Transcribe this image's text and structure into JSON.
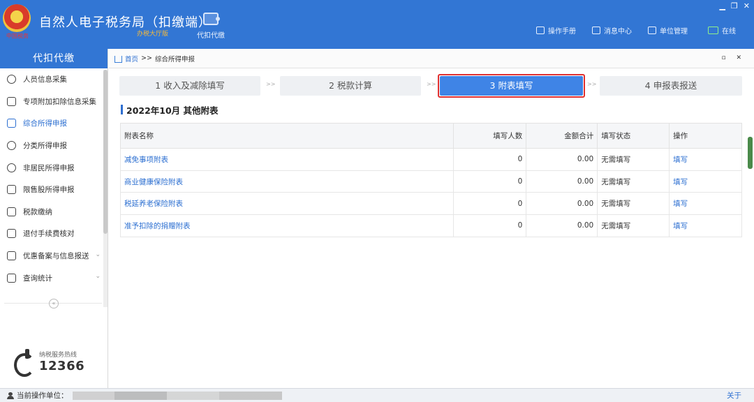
{
  "header": {
    "emblem_text": "中国税务",
    "app_title": "自然人电子税务局（扣缴端）",
    "app_subtitle": "办税大厅版",
    "module_label": "代扣代缴",
    "nav": [
      {
        "label": "操作手册",
        "icon": "book-icon"
      },
      {
        "label": "消息中心",
        "icon": "mail-icon"
      },
      {
        "label": "单位管理",
        "icon": "building-icon"
      }
    ],
    "online_label": "在线",
    "window_controls": {
      "min": "▁",
      "max": "❐",
      "close": "✕"
    }
  },
  "sidebar": {
    "title": "代扣代缴",
    "items": [
      {
        "label": "人员信息采集",
        "icon": "person-icon",
        "active": false
      },
      {
        "label": "专项附加扣除信息采集",
        "icon": "list-icon",
        "active": false
      },
      {
        "label": "综合所得申报",
        "icon": "layers-icon",
        "active": true
      },
      {
        "label": "分类所得申报",
        "icon": "pie-icon",
        "active": false
      },
      {
        "label": "非居民所得申报",
        "icon": "person-icon",
        "active": false
      },
      {
        "label": "限售股所得申报",
        "icon": "bar-chart-icon",
        "active": false
      },
      {
        "label": "税款缴纳",
        "icon": "wallet-icon",
        "active": false
      },
      {
        "label": "退付手续费核对",
        "icon": "document-icon",
        "active": false
      },
      {
        "label": "优惠备案与信息报送",
        "icon": "file-icon",
        "active": false,
        "expandable": true
      },
      {
        "label": "查询统计",
        "icon": "search-list-icon",
        "active": false,
        "expandable": true
      }
    ],
    "collapse_symbol": "«",
    "hotline_label": "纳税服务热线",
    "hotline_number": "12366"
  },
  "main": {
    "breadcrumb": {
      "home": "首页",
      "sep": ">>",
      "current": "综合所得申报"
    },
    "panel_controls": "▫ ✕",
    "steps": [
      {
        "label": "1 收入及减除填写",
        "active": false
      },
      {
        "label": "2 税款计算",
        "active": false
      },
      {
        "label": "3 附表填写",
        "active": true
      },
      {
        "label": "4 申报表报送",
        "active": false
      }
    ],
    "step_arrow": ">>",
    "section_title": "2022年10月  其他附表",
    "table": {
      "headers": [
        "附表名称",
        "填写人数",
        "金额合计",
        "填写状态",
        "操作"
      ],
      "rows": [
        [
          "减免事项附表",
          "0",
          "0.00",
          "无需填写",
          "填写"
        ],
        [
          "商业健康保险附表",
          "0",
          "0.00",
          "无需填写",
          "填写"
        ],
        [
          "税延养老保险附表",
          "0",
          "0.00",
          "无需填写",
          "填写"
        ],
        [
          "准予扣除的捐赠附表",
          "0",
          "0.00",
          "无需填写",
          "填写"
        ]
      ]
    }
  },
  "statusbar": {
    "unit_label": "当前操作单位：",
    "about": "关于"
  },
  "colors": {
    "brand_blue": "#3276d4",
    "active_step": "#3f84e6",
    "highlight_red": "#e03131",
    "link_blue": "#2c6fd1"
  }
}
